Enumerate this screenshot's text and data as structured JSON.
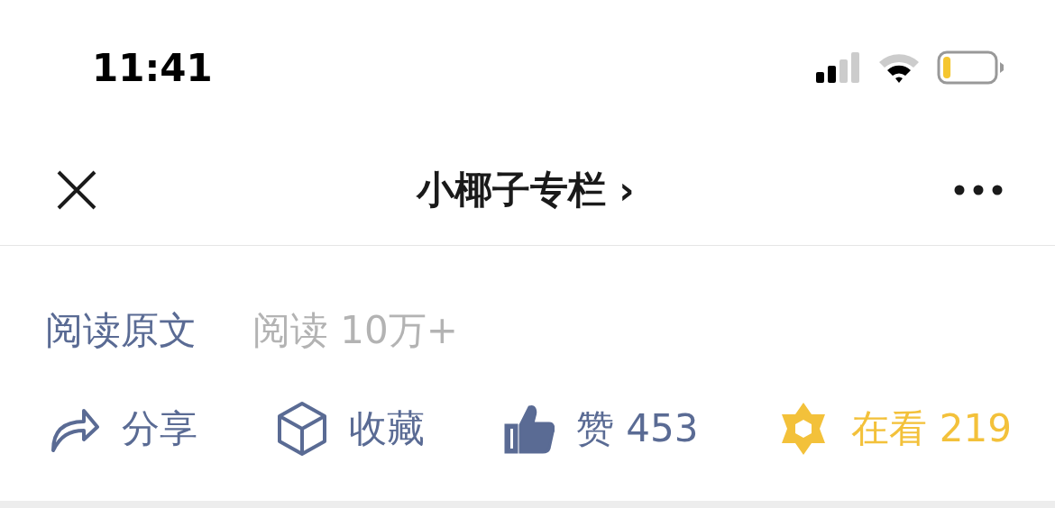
{
  "status_bar": {
    "time": "11:41"
  },
  "nav": {
    "title": "小椰子专栏",
    "chevron": "›"
  },
  "meta": {
    "read_original": "阅读原文",
    "read_count": "阅读 10万+"
  },
  "actions": [
    {
      "kind": "share",
      "label": "分享",
      "selected": false
    },
    {
      "kind": "favorite",
      "label": "收藏",
      "selected": false
    },
    {
      "kind": "like",
      "label": "赞 453",
      "selected": true
    },
    {
      "kind": "wow",
      "label": "在看 219",
      "selected": true
    }
  ]
}
